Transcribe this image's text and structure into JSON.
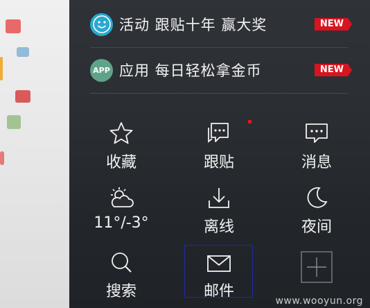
{
  "promos": [
    {
      "label": "活动 跟贴十年 赢大奖",
      "badge": "NEW",
      "icon": "smiley-icon",
      "color": "#29a9cf"
    },
    {
      "label": "应用 每日轻松拿金币",
      "badge": "NEW",
      "icon": "app-icon",
      "icon_text": "APP",
      "color": "#5fa489"
    }
  ],
  "grid": [
    {
      "label": "收藏",
      "icon": "star-icon"
    },
    {
      "label": "跟贴",
      "icon": "comment-icon"
    },
    {
      "label": "消息",
      "icon": "message-icon"
    },
    {
      "label": "11°/-3°",
      "icon": "weather-icon"
    },
    {
      "label": "离线",
      "icon": "download-icon"
    },
    {
      "label": "夜间",
      "icon": "moon-icon"
    },
    {
      "label": "搜索",
      "icon": "search-icon"
    },
    {
      "label": "邮件",
      "icon": "mail-icon"
    },
    {
      "label": "",
      "icon": "add-icon"
    }
  ],
  "watermark": "www.wooyun.org",
  "colors": {
    "new_badge": "#d8141f",
    "text": "#f2f2f2",
    "selection": "#1e2aa8"
  }
}
